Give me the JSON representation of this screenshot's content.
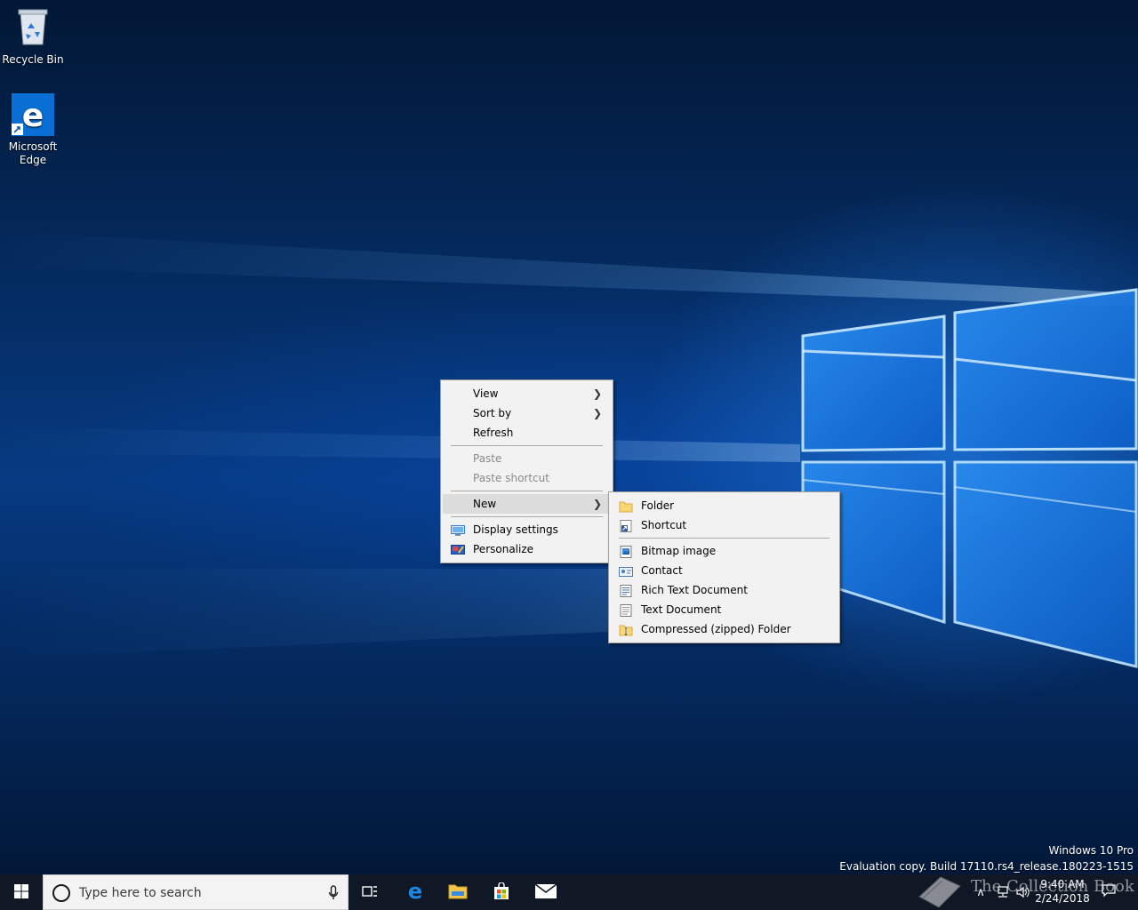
{
  "desktop": {
    "icons": [
      {
        "label": "Recycle Bin",
        "icon": "recycle-bin-icon"
      },
      {
        "label": "Microsoft Edge",
        "icon": "edge-icon"
      }
    ]
  },
  "context_menu": {
    "items": [
      {
        "label": "View",
        "has_submenu": true
      },
      {
        "label": "Sort by",
        "has_submenu": true
      },
      {
        "label": "Refresh"
      },
      {
        "label": "Paste",
        "disabled": true
      },
      {
        "label": "Paste shortcut",
        "disabled": true
      },
      {
        "label": "New",
        "has_submenu": true,
        "active": true
      },
      {
        "label": "Display settings",
        "icon": "display-settings-icon"
      },
      {
        "label": "Personalize",
        "icon": "personalize-icon"
      }
    ]
  },
  "new_submenu": {
    "items": [
      {
        "label": "Folder",
        "icon": "folder-icon"
      },
      {
        "label": "Shortcut",
        "icon": "shortcut-icon"
      },
      {
        "label": "Bitmap image",
        "icon": "bitmap-image-icon"
      },
      {
        "label": "Contact",
        "icon": "contact-icon"
      },
      {
        "label": "Rich Text Document",
        "icon": "rich-text-document-icon"
      },
      {
        "label": "Text Document",
        "icon": "text-document-icon"
      },
      {
        "label": "Compressed (zipped) Folder",
        "icon": "zip-folder-icon"
      }
    ]
  },
  "watermark": {
    "edition": "Windows 10 Pro",
    "build": "Evaluation copy. Build 17110.rs4_release.180223-1515"
  },
  "taskbar": {
    "search_placeholder": "Type here to search",
    "pinned": [
      "task-view-icon",
      "edge-icon",
      "file-explorer-icon",
      "store-icon",
      "mail-icon"
    ],
    "clock": {
      "time": "9:40 AM",
      "date": "2/24/2018"
    }
  },
  "overlay_watermark": "The Collection Book",
  "colors": {
    "taskbar": "#101826",
    "menu_bg": "#f2f2f2",
    "menu_active": "#dcdcdc",
    "accent": "#0078d7"
  }
}
